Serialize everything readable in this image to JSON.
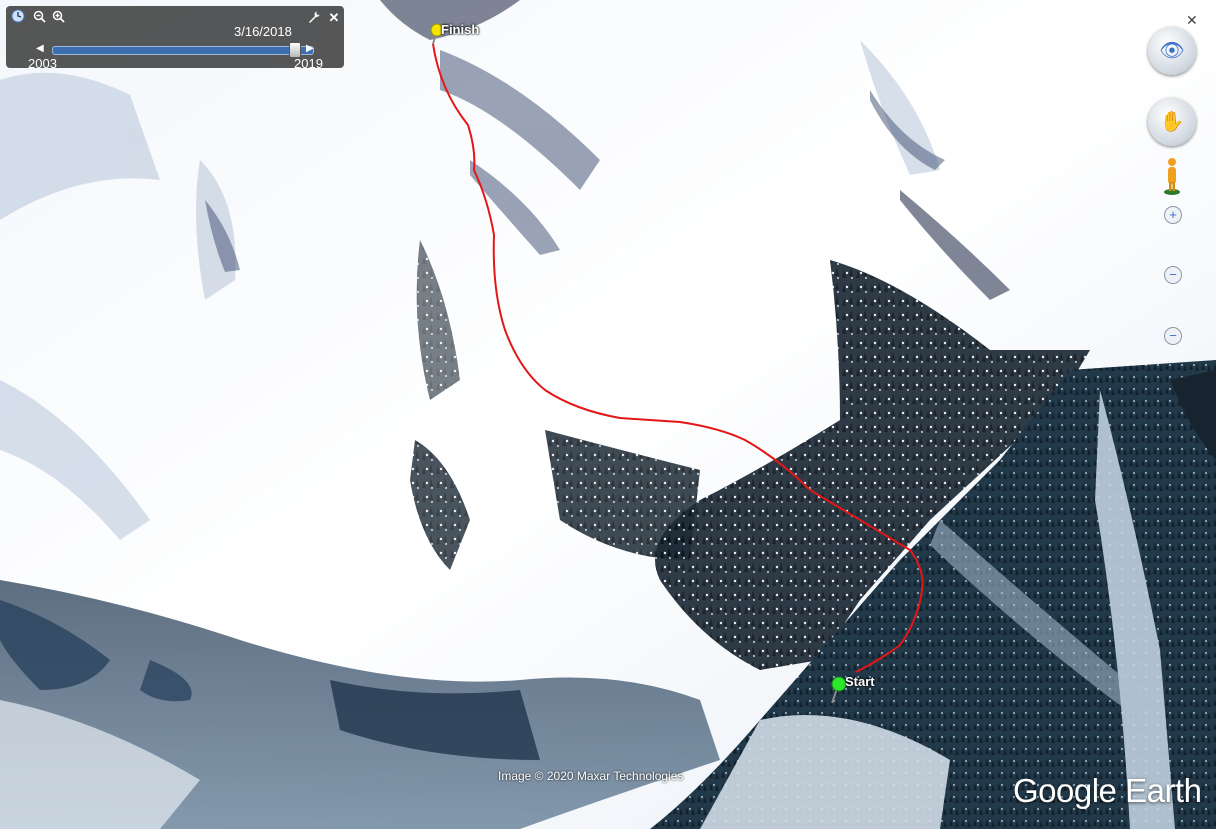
{
  "time_slider": {
    "date": "3/16/2018",
    "start_year": "2003",
    "end_year": "2019",
    "position_fraction": 0.93
  },
  "placemarks": {
    "start_label": "Start",
    "finish_label": "Finish",
    "start_color": "#2ee82e",
    "finish_color": "#f2e600"
  },
  "track": {
    "color": "#e41616"
  },
  "attribution": "Image © 2020 Maxar Technologies",
  "logo": "Google Earth",
  "icons": {
    "slider_clock": "clock-icon",
    "zoom_out": "zoom-out-icon",
    "zoom_in": "zoom-in-icon",
    "settings": "wrench-icon",
    "close": "close-icon",
    "look": "eye-icon",
    "move": "hand-icon",
    "street_view": "pegman-icon"
  }
}
